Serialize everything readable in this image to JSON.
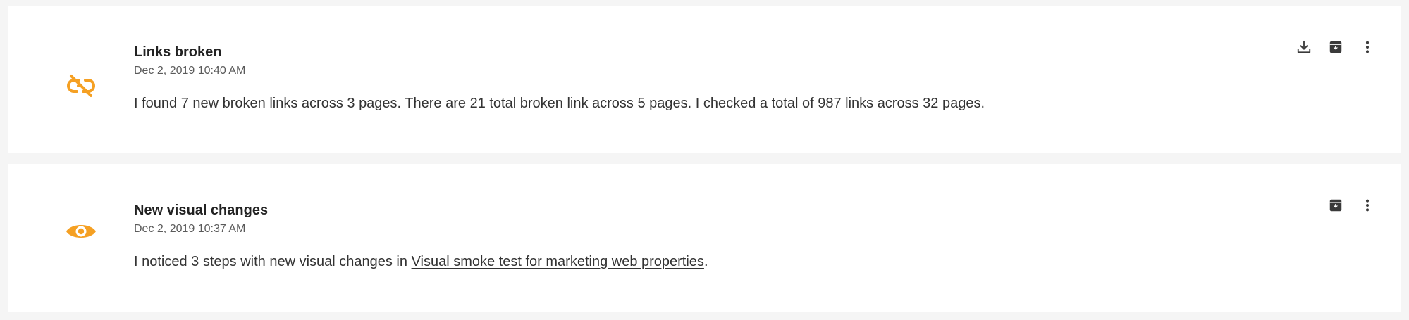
{
  "accent_color": "#f5a023",
  "icon_color": "#3a3a3a",
  "notifications": [
    {
      "icon": "broken-link-icon",
      "title": "Links broken",
      "timestamp": "Dec 2, 2019 10:40 AM",
      "message": "I found 7 new broken links across 3 pages. There are 21 total broken link across 5 pages. I checked a total of 987 links across 32 pages.",
      "actions": [
        "download-icon",
        "archive-icon",
        "more-vertical-icon"
      ]
    },
    {
      "icon": "eye-icon",
      "title": "New visual changes",
      "timestamp": "Dec 2, 2019 10:37 AM",
      "message_prefix": "I noticed 3 steps with new visual changes in ",
      "message_link": "Visual smoke test for marketing web properties",
      "message_suffix": ".",
      "actions": [
        "archive-icon",
        "more-vertical-icon"
      ]
    }
  ]
}
